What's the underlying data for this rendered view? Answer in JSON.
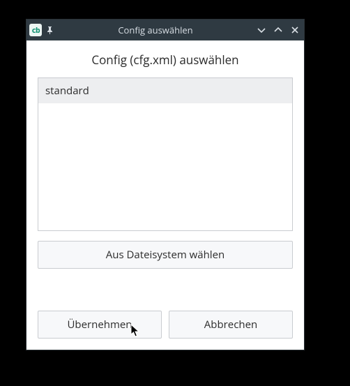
{
  "titlebar": {
    "app_icon_text": "cb",
    "title": "Config auswählen"
  },
  "dialog": {
    "heading": "Config (cfg.xml) auswählen",
    "list": {
      "items": [
        "standard"
      ]
    },
    "filesystem_button": "Aus Dateisystem wählen",
    "apply_button": "Übernehmen",
    "cancel_button": "Abbrechen"
  }
}
